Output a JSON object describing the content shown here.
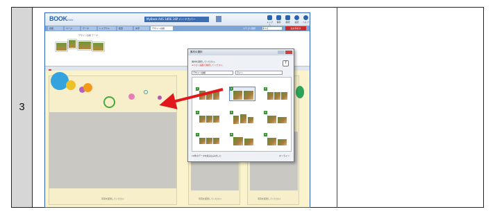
{
  "step": "3",
  "app": {
    "logo": "BOOK",
    "logo_sub": "Editor",
    "title": "MyBook A4S 18RE 16P ハードカバー",
    "toolbar_icons": [
      {
        "name": "home-icon",
        "label": "トップへ"
      },
      {
        "name": "save-icon",
        "label": "保存"
      },
      {
        "name": "preview-icon",
        "label": "確認"
      },
      {
        "name": "settings-icon",
        "label": "設定"
      },
      {
        "name": "help-icon",
        "label": "ヘルプ"
      }
    ],
    "tabs": [
      "表紙",
      "ページ",
      "テーマ",
      "レイアウト",
      "配置",
      "文字",
      "デザイン台紙"
    ],
    "active_tab": "デザイン台紙",
    "size_label": "カテゴリ選択",
    "size_value": "すべて",
    "order_button": "注文手続き"
  },
  "thumbs_caption": "デザイン台紙 テーマ",
  "page_captions": [
    "写真を配置してください",
    "写真を配置してください",
    "写真を配置してください"
  ],
  "dialog": {
    "title": "素材の選択",
    "instruction1": "素材を選択してください。",
    "instruction2": "※小さく画面で確認してください。",
    "help": "?",
    "dropdown1": "デザイン台紙",
    "dropdown2": "ライン",
    "status": "10件のデータを読み込みました",
    "online": "オンライン",
    "layout_numbers": [
      "1",
      "2",
      "3",
      "4",
      "5",
      "6",
      "7",
      "8",
      "9"
    ]
  }
}
